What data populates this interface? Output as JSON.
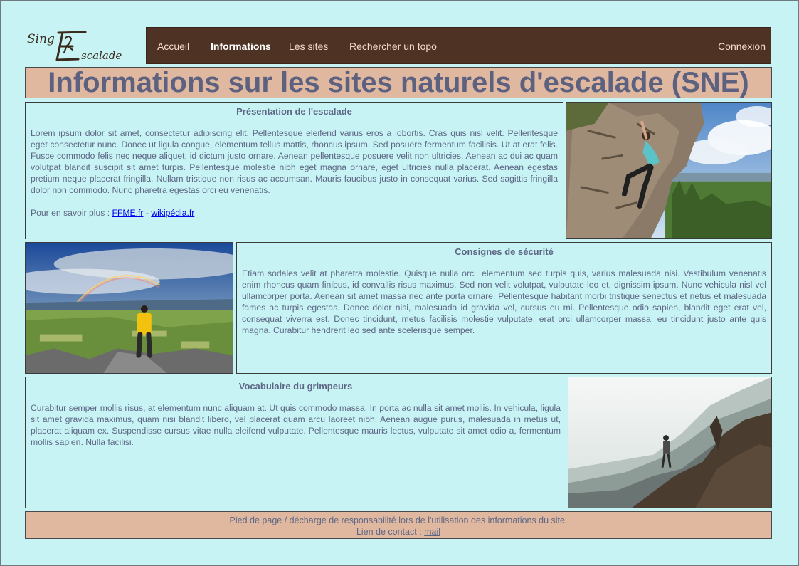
{
  "brand": {
    "logo_text_top": "Sing",
    "logo_text_bottom": "Escalade"
  },
  "nav": {
    "items": [
      {
        "label": "Accueil"
      },
      {
        "label": "Informations"
      },
      {
        "label": "Les sites"
      },
      {
        "label": "Rechercher un topo"
      }
    ],
    "login": "Connexion"
  },
  "page_title": "Informations sur les sites naturels d'escalade (SNE)",
  "sections": {
    "presentation": {
      "title": "Présentation de l'escalade",
      "body": "Lorem ipsum dolor sit amet, consectetur adipiscing elit. Pellentesque eleifend varius eros a lobortis. Cras quis nisl velit. Pellentesque eget consectetur nunc. Donec ut ligula congue, elementum tellus mattis, rhoncus ipsum. Sed posuere fermentum facilisis. Ut at erat felis. Fusce commodo felis nec neque aliquet, id dictum justo ornare. Aenean pellentesque posuere velit non ultricies. Aenean ac dui ac quam volutpat blandit suscipit sit amet turpis. Pellentesque molestie nibh eget magna ornare, eget ultricies nulla placerat. Aenean egestas pretium neque placerat fringilla. Nullam tristique non risus ac accumsan. Mauris faucibus justo in consequat varius. Sed sagittis fringilla dolor non commodo. Nunc pharetra egestas orci eu venenatis.",
      "more_prefix": "Pour en savoir plus : ",
      "link1": "FFME.fr",
      "separator": " - ",
      "link2": "wikipédia.fr"
    },
    "securite": {
      "title": "Consignes de sécurité",
      "body": "Etiam sodales velit at pharetra molestie. Quisque nulla orci, elementum sed turpis quis, varius malesuada nisi. Vestibulum venenatis enim rhoncus quam finibus, id convallis risus maximus. Sed non velit volutpat, vulputate leo et, dignissim ipsum. Nunc vehicula nisl vel ullamcorper porta. Aenean sit amet massa nec ante porta ornare. Pellentesque habitant morbi tristique senectus et netus et malesuada fames ac turpis egestas. Donec dolor nisi, malesuada id gravida vel, cursus eu mi. Pellentesque odio sapien, blandit eget erat vel, consequat viverra est. Donec tincidunt, metus facilisis molestie vulputate, erat orci ullamcorper massa, eu tincidunt justo ante quis magna. Curabitur hendrerit leo sed ante scelerisque semper."
    },
    "vocabulaire": {
      "title": "Vocabulaire du grimpeurs",
      "body": "Curabitur semper mollis risus, at elementum nunc aliquam at. Ut quis commodo massa. In porta ac nulla sit amet mollis. In vehicula, ligula sit amet gravida maximus, quam nisi blandit libero, vel placerat quam arcu laoreet nibh. Aenean augue purus, malesuada in metus ut, placerat aliquam ex. Suspendisse cursus vitae nulla eleifend vulputate. Pellentesque mauris lectus, vulputate sit amet odio a, fermentum mollis sapien. Nulla facilisi."
    }
  },
  "footer": {
    "line1": "Pied de page / décharge de responsabilité lors de l'utilisation des informations du site.",
    "contact_prefix": "Lien de contact : ",
    "contact_link": "mail"
  },
  "colors": {
    "background": "#c8f3f4",
    "nav_bg": "#4e3223",
    "accent_panel": "#e0b8a0",
    "text": "#5d6785"
  }
}
